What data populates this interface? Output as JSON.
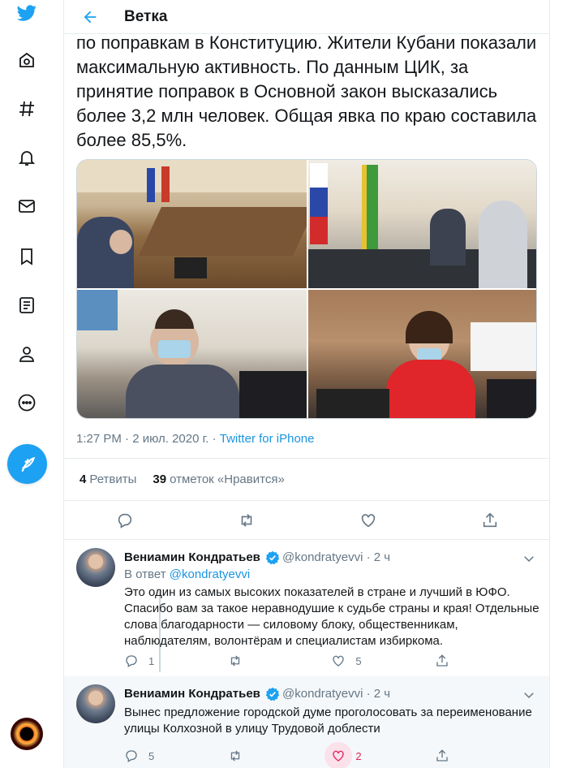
{
  "header": {
    "title": "Ветка"
  },
  "nav": {
    "items": [
      "twitter-logo",
      "home-icon",
      "explore-icon",
      "notifications-icon",
      "messages-icon",
      "bookmarks-icon",
      "lists-icon",
      "profile-icon",
      "more-icon"
    ],
    "compose_icon": "compose-tweet-icon"
  },
  "tweet": {
    "text": "по поправкам в Конституцию. Жители Кубани показали максимальную активность. По данным ЦИК, за принятие поправок в Основной закон высказались более 3,2 млн человек. Общая явка по краю составила более 85,5%.",
    "timestamp": "1:27 PM · 2 июл. 2020 г. · ",
    "source": "Twitter for iPhone",
    "retweets_count": "4",
    "retweets_label": "Ретвиты",
    "likes_count": "39",
    "likes_label": "отметок «Нравится»",
    "photos": 4
  },
  "replies": [
    {
      "name": "Вениамин Кондратьев",
      "handle": "@kondratyevvi · 2 ч",
      "reply_to_prefix": "В ответ ",
      "reply_to_handle": "@kondratyevvi",
      "text": "Это один из самых высоких показателей в стране и лучший в ЮФО. Спасибо вам за такое неравнодушие к судьбе страны и края! Отдельные слова благодарности — силовому блоку, общественникам, наблюдателям, волонтёрам и специалистам избиркома.",
      "replies": "1",
      "retweets": "",
      "likes": "5"
    },
    {
      "name": "Вениамин Кондратьев",
      "handle": "@kondratyevvi · 2 ч",
      "text": "Вынес предложение городской думе проголосовать за переименование улицы Колхозной в улицу Трудовой доблести",
      "replies": "5",
      "retweets": "",
      "likes": "2"
    }
  ],
  "colors": {
    "accent": "#1da1f2",
    "liked": "#e0245e",
    "muted": "#657786"
  }
}
